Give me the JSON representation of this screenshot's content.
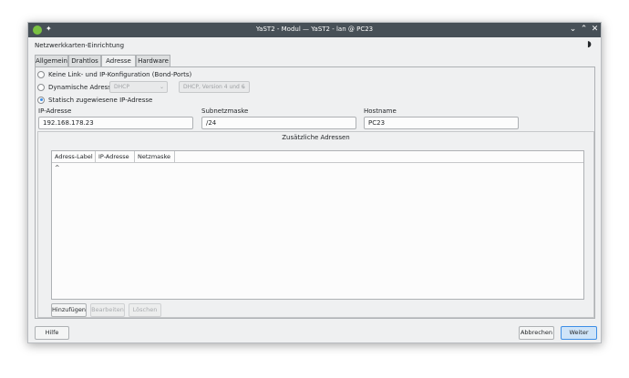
{
  "window": {
    "title": "YaST2 - Modul — YaST2 - lan @ PC23",
    "controls": {
      "minimize": "⌄",
      "maximize": "⌃",
      "close": "✕"
    }
  },
  "heading": "Netzwerkkarten-Einrichtung",
  "tabs": [
    {
      "label": "Allgemein",
      "active": false
    },
    {
      "label": "Drahtlos",
      "active": false
    },
    {
      "label": "Adresse",
      "active": true
    },
    {
      "label": "Hardware",
      "active": false
    }
  ],
  "address_mode": {
    "options": [
      {
        "label": "Keine Link- und IP-Konfiguration (Bond-Ports)",
        "checked": false
      },
      {
        "label": "Dynamische Adresse",
        "checked": false
      },
      {
        "label": "Statisch zugewiesene IP-Adresse",
        "checked": true
      }
    ],
    "dhcp_select": "DHCP",
    "dhcp_version_select": "DHCP, Version 4 und 6"
  },
  "fields": {
    "ip_label": "IP-Adresse",
    "ip_value": "192.168.178.23",
    "mask_label": "Subnetzmaske",
    "mask_value": "/24",
    "hostname_label": "Hostname",
    "hostname_value": "PC23"
  },
  "additional": {
    "title": "Zusätzliche Adressen",
    "columns": [
      "Adress-Label",
      "IP-Adresse",
      "Netzmaske"
    ],
    "sort_indicator": "^",
    "rows": [],
    "buttons": {
      "add": "Hinzufügen",
      "edit": "Bearbeiten",
      "delete": "Löschen"
    }
  },
  "footer": {
    "help": "Hilfe",
    "cancel": "Abbrechen",
    "next": "Weiter"
  },
  "colors": {
    "titlebar": "#475057",
    "accent": "#3d8ee6",
    "window_bg": "#eff0f1"
  }
}
